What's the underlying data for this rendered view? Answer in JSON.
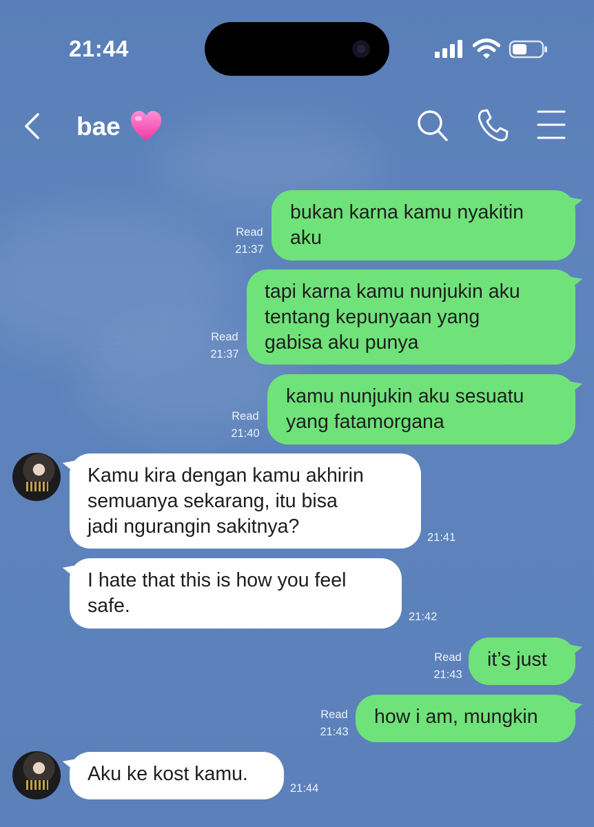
{
  "status_bar": {
    "time": "21:44",
    "icons": [
      "cellular-signal-icon",
      "wifi-icon",
      "battery-icon"
    ]
  },
  "header": {
    "title": "bae",
    "title_emoji": "pink-heart",
    "icons": [
      "back-chevron-icon",
      "search-icon",
      "phone-icon",
      "menu-icon"
    ]
  },
  "messages": [
    {
      "side": "sent",
      "text": "bukan karna kamu nyakitin\naku",
      "read": "Read",
      "time": "21:37"
    },
    {
      "side": "sent",
      "text": "tapi karna kamu nunjukin aku\ntentang kepunyaan yang\ngabisa aku punya",
      "read": "Read",
      "time": "21:37"
    },
    {
      "side": "sent",
      "text": "kamu nunjukin aku sesuatu\nyang fatamorgana",
      "read": "Read",
      "time": "21:40"
    },
    {
      "side": "received",
      "text": "Kamu kira dengan kamu akhirin\nsemuanya sekarang, itu bisa\njadi ngurangin sakitnya?",
      "time": "21:41"
    },
    {
      "side": "received",
      "text": "I hate that this is how you feel\nsafe.",
      "time": "21:42"
    },
    {
      "side": "sent",
      "text": "it’s just",
      "read": "Read",
      "time": "21:43"
    },
    {
      "side": "sent",
      "text": "how i am, mungkin",
      "read": "Read",
      "time": "21:43"
    },
    {
      "side": "received",
      "text": "Aku ke kost kamu.",
      "time": "21:44"
    }
  ],
  "colors": {
    "background": "#5b80ba",
    "sent_bubble": "#6fe27a",
    "received_bubble": "#ffffff"
  }
}
